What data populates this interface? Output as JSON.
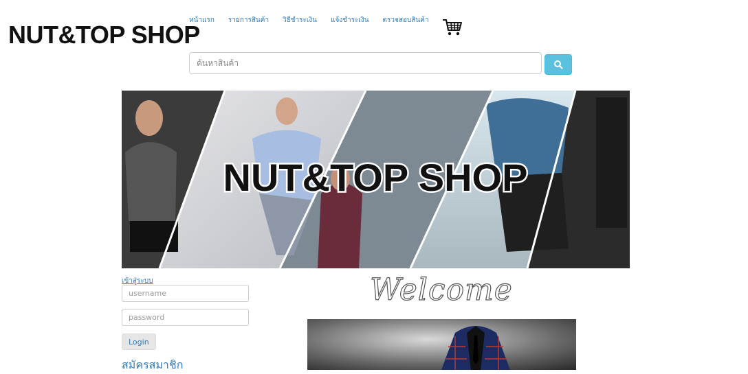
{
  "header": {
    "logo": "NUT&TOP SHOP",
    "nav": [
      "หน้าแรก",
      "รายการสินค้า",
      "วิธีชำระเงิน",
      "แจ้งชำระเงิน",
      "ตรวจสอบสินค้า"
    ],
    "cart_icon": "cart-icon"
  },
  "search": {
    "placeholder": "ค้นหาสินค้า",
    "button_icon": "search-icon"
  },
  "banner": {
    "title": "NUT&TOP SHOP"
  },
  "login": {
    "title": "เข้าสู่ระบบ",
    "username_placeholder": "username",
    "password_placeholder": "password",
    "login_label": "Login",
    "register_label": "สมัครสมาชิก"
  },
  "main": {
    "welcome": "Welcome"
  },
  "colors": {
    "link": "#337ab7",
    "search_button": "#5bc0de"
  }
}
